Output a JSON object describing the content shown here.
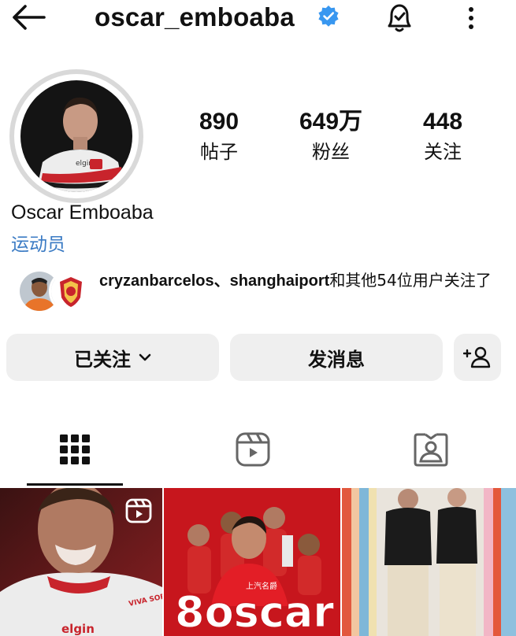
{
  "header": {
    "username": "oscar_emboaba",
    "back_icon": "back-arrow-icon",
    "verified_icon": "verified-badge-icon",
    "notification_icon": "notification-bell-icon",
    "more_icon": "more-options-icon"
  },
  "profile": {
    "full_name": "Oscar Emboaba",
    "category": "运动员",
    "jersey_text": "elgin"
  },
  "stats": [
    {
      "value": "890",
      "label": "帖子"
    },
    {
      "value": "649万",
      "label": "粉丝"
    },
    {
      "value": "448",
      "label": "关注"
    }
  ],
  "followed_by": {
    "users": "cryzanbarcelos、shanghaiport",
    "rest": "和其他54位用户关注了"
  },
  "actions": {
    "following_label": "已关注",
    "message_label": "发消息",
    "add_user_icon": "add-user-icon"
  },
  "tabs": [
    {
      "name": "grid",
      "icon": "grid-icon",
      "active": true
    },
    {
      "name": "reels",
      "icon": "reels-icon",
      "active": false
    },
    {
      "name": "tagged",
      "icon": "tagged-person-icon",
      "active": false
    }
  ],
  "posts": [
    {
      "kind": "reel",
      "jersey_text": "elgin",
      "sleeve_text": "VIVA SORTE"
    },
    {
      "kind": "image",
      "headline": "8oscar",
      "sponsor_text": "上汽名爵"
    },
    {
      "kind": "image"
    }
  ],
  "colors": {
    "accent_blue": "#3b7bc4",
    "verified_blue": "#3897f0",
    "button_bg": "#efefef"
  }
}
